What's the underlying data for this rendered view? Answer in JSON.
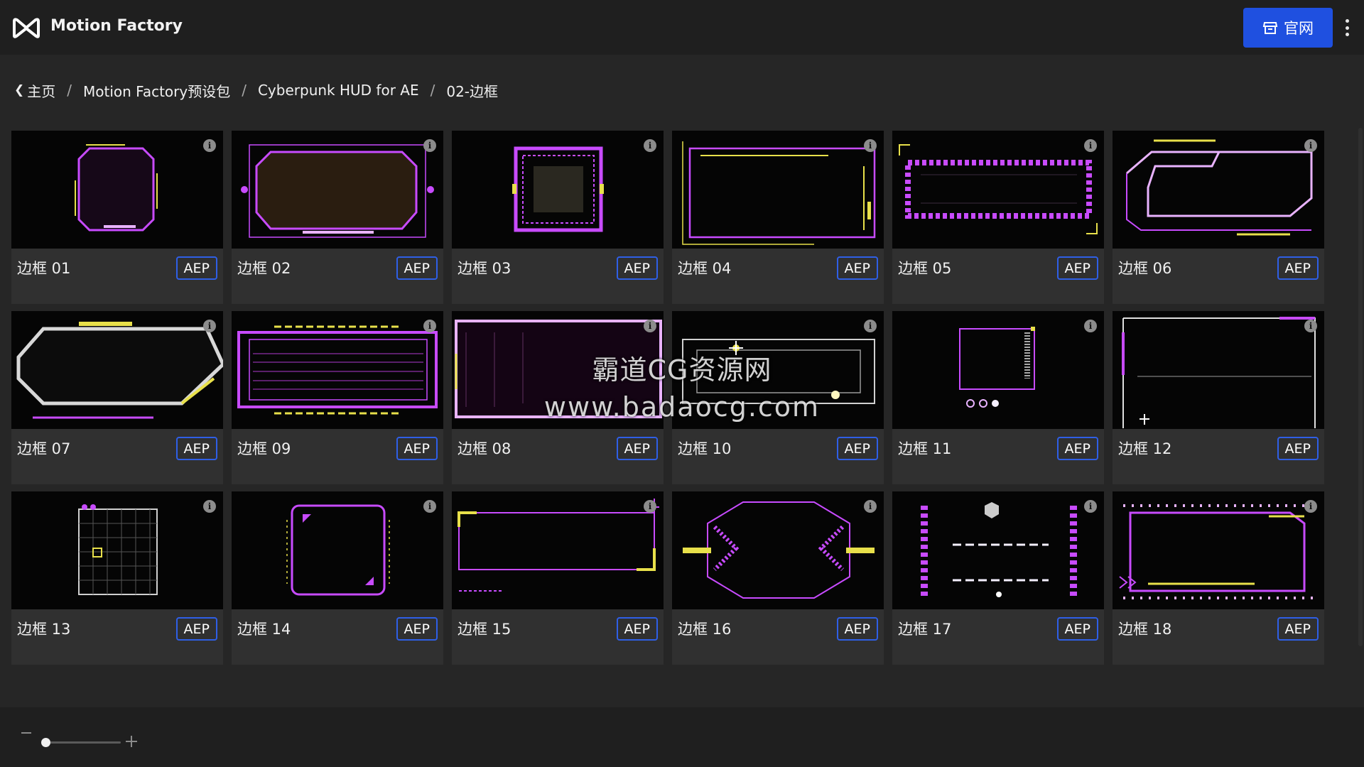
{
  "app": {
    "title": "Motion Factory",
    "logo_icon": "motion-factory-logo-icon",
    "official_label": "官网",
    "official_icon": "storefront-icon",
    "menu_icon": "kebab-menu-icon"
  },
  "breadcrumb": {
    "back_icon": "chevron-left-icon",
    "items": [
      "主页",
      "Motion Factory预设包",
      "Cyberpunk HUD for AE",
      "02-边框"
    ],
    "separator": "/"
  },
  "cards": [
    {
      "title": "边框 01",
      "badge": "AEP"
    },
    {
      "title": "边框 02",
      "badge": "AEP"
    },
    {
      "title": "边框 03",
      "badge": "AEP"
    },
    {
      "title": "边框 04",
      "badge": "AEP"
    },
    {
      "title": "边框 05",
      "badge": "AEP"
    },
    {
      "title": "边框 06",
      "badge": "AEP"
    },
    {
      "title": "边框 07",
      "badge": "AEP"
    },
    {
      "title": "边框 09",
      "badge": "AEP"
    },
    {
      "title": "边框 08",
      "badge": "AEP"
    },
    {
      "title": "边框 10",
      "badge": "AEP"
    },
    {
      "title": "边框 11",
      "badge": "AEP"
    },
    {
      "title": "边框 12",
      "badge": "AEP"
    },
    {
      "title": "边框 13",
      "badge": "AEP"
    },
    {
      "title": "边框 14",
      "badge": "AEP"
    },
    {
      "title": "边框 15",
      "badge": "AEP"
    },
    {
      "title": "边框 16",
      "badge": "AEP"
    },
    {
      "title": "边框 17",
      "badge": "AEP"
    },
    {
      "title": "边框 18",
      "badge": "AEP"
    }
  ],
  "info_icon": "info-icon",
  "info_glyph": "i",
  "watermark": {
    "line1": "霸道CG资源网",
    "line2": "www.badaocg.com"
  },
  "zoom": {
    "level": 0.05,
    "minus_icon": "minus-icon",
    "plus_icon": "plus-icon"
  },
  "colors": {
    "accent": "#1f50e0",
    "neon_purple": "#c84bff",
    "neon_yellow": "#e8e04a"
  }
}
